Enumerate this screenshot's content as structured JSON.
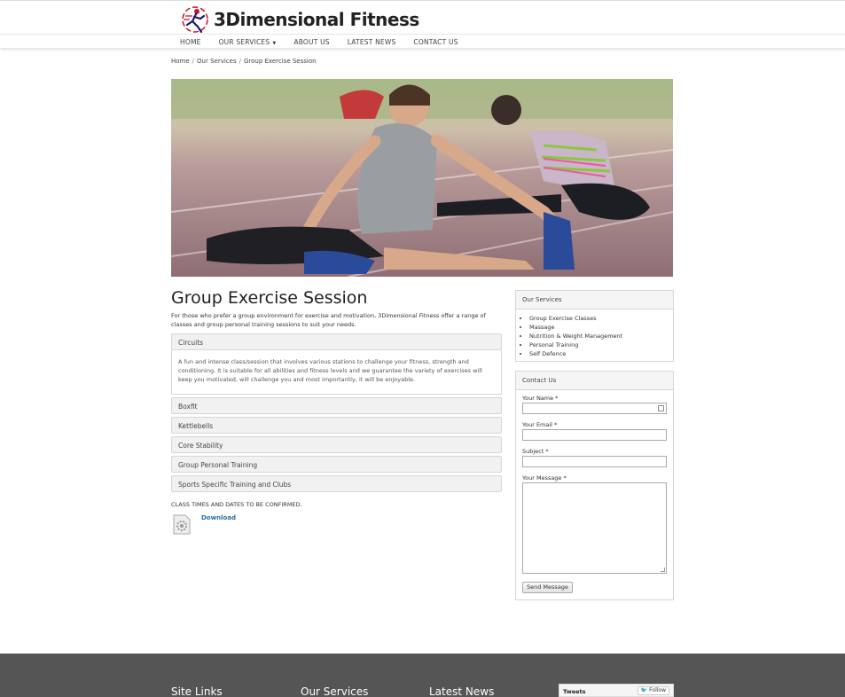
{
  "header": {
    "logo_text": "3Dimensional Fitness",
    "nav": [
      {
        "label": "HOME"
      },
      {
        "label": "OUR SERVICES",
        "has_dropdown": true
      },
      {
        "label": "ABOUT US"
      },
      {
        "label": "LATEST NEWS"
      },
      {
        "label": "CONTACT US"
      }
    ]
  },
  "breadcrumb": {
    "items": [
      "Home",
      "Our Services",
      "Group Exercise Session"
    ],
    "separator": "/"
  },
  "main": {
    "title": "Group Exercise Session",
    "intro": "For those who prefer a group environment for exercise and motivation, 3Dimensional Fitness offer a range of classes and group personal training sessions to suit your needs.",
    "accordion": [
      {
        "label": "Circuits",
        "expanded": true,
        "body": "A fun and intense class/session that involves various stations to challenge your fitness, strength and conditioning. It is suitable for all abilities and fitness levels and we guarantee the variety of exercises will keep you motivated, will challenge you and most importantly, it will be enjoyable."
      },
      {
        "label": "Boxfit"
      },
      {
        "label": "Kettlebells"
      },
      {
        "label": "Core Stability"
      },
      {
        "label": "Group Personal Training"
      },
      {
        "label": "Sports Specific Training and Clubs"
      }
    ],
    "confirm_text": "CLASS TIMES AND DATES TO BE CONFIRMED.",
    "download_label": "Download"
  },
  "sidebar": {
    "services": {
      "title": "Our Services",
      "items": [
        "Group Exercise Classes",
        "Massage",
        "Nutrition & Weight Management",
        "Personal Training",
        "Self Defence"
      ]
    },
    "contact": {
      "title": "Contact Us",
      "name_label": "Your Name *",
      "email_label": "Your Email *",
      "subject_label": "Subject *",
      "message_label": "Your Message *",
      "submit_label": "Send Message"
    }
  },
  "footer": {
    "columns": [
      "Site Links",
      "Our Services",
      "Latest News"
    ],
    "tweets_label": "Tweets",
    "follow_label": "Follow"
  },
  "colors": {
    "accent": "#2a6ea6",
    "footer_bg": "#555555",
    "panel_bg": "#f1f1f1"
  }
}
